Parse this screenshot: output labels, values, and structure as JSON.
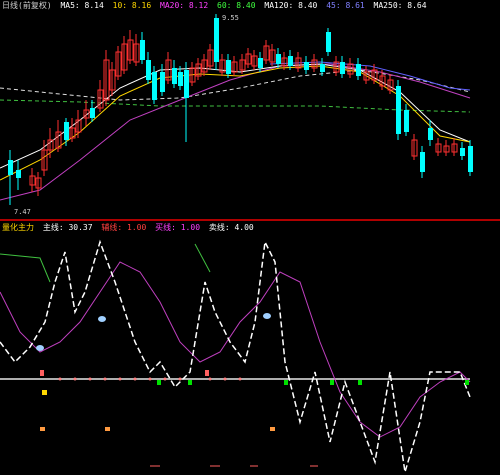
{
  "top_legend": {
    "title": "日线(前复权)",
    "ma_items": [
      {
        "label": "MA5: 8.14",
        "color": "#ffffff"
      },
      {
        "label": "10: 8.16",
        "color": "#ffd700"
      },
      {
        "label": "MA20: 8.12",
        "color": "#ff40ff"
      },
      {
        "label": "60: 8.40",
        "color": "#40ff40"
      },
      {
        "label": "MA120: 8.40",
        "color": "#ffffff"
      },
      {
        "label": "45: 8.61",
        "color": "#8080ff"
      },
      {
        "label": "MA250: 8.64",
        "color": "#ffffff"
      }
    ]
  },
  "top_labels": {
    "high_price": "9.55",
    "low_price": "7.47"
  },
  "bottom_legend": {
    "title": "量化主力",
    "items": [
      {
        "label": "主线: 30.37",
        "color": "#ffffff"
      },
      {
        "label": "辅线: 1.00",
        "color": "#ff4040"
      },
      {
        "label": "买线: 1.00",
        "color": "#ff40ff"
      },
      {
        "label": "卖线: 4.00",
        "color": "#ffffff"
      }
    ]
  },
  "colors": {
    "up": "#ff3030",
    "down": "#00ffff",
    "ma_white": "#ffffff",
    "ma_yellow": "#ffd700",
    "ma_magenta": "#c040c0",
    "ma_green": "#40c040",
    "ma_blue": "#6060ff",
    "baseline": "#e8e8e8",
    "buy_marker": "#ff8080",
    "sell_marker": "#00e000"
  }
}
